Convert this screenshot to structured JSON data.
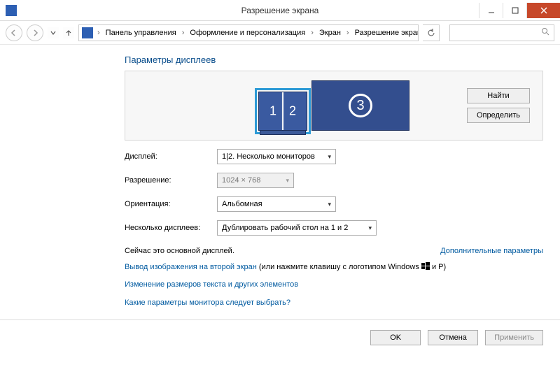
{
  "window": {
    "title": "Разрешение экрана"
  },
  "breadcrumb": {
    "items": [
      "Панель управления",
      "Оформление и персонализация",
      "Экран",
      "Разрешение экрана"
    ]
  },
  "heading": "Параметры дисплеев",
  "monitors": {
    "label1": "1",
    "label2": "2",
    "label3": "3"
  },
  "buttons": {
    "find": "Найти",
    "detect": "Определить",
    "ok": "OK",
    "cancel": "Отмена",
    "apply": "Применить"
  },
  "form": {
    "display_label": "Дисплей:",
    "display_value": "1|2. Несколько мониторов",
    "resolution_label": "Разрешение:",
    "resolution_value": "1024 × 768",
    "orientation_label": "Ориентация:",
    "orientation_value": "Альбомная",
    "multi_label": "Несколько дисплеев:",
    "multi_value": "Дублировать рабочий стол на 1 и 2"
  },
  "messages": {
    "primary": "Сейчас это основной дисплей.",
    "advanced": "Дополнительные параметры",
    "project_link": "Вывод изображения на второй экран",
    "project_suffix_a": " (или нажмите клавишу с логотипом Windows ",
    "project_suffix_b": " и P)",
    "resize_link": "Изменение размеров текста и других элементов",
    "which_link": "Какие параметры монитора следует выбрать?"
  }
}
